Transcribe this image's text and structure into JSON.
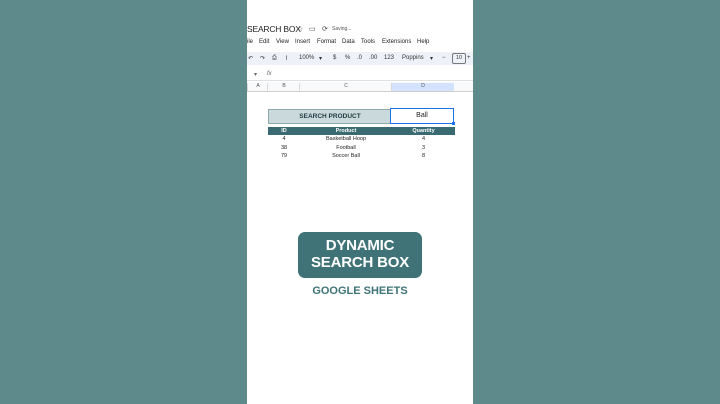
{
  "sheet": {
    "title": "SEARCH BOX",
    "saving_status": "Saving...",
    "title_icons": {
      "star": "star-icon",
      "folder": "folder-move-icon",
      "sync": "sync-icon"
    },
    "menu": [
      "ile",
      "Edit",
      "View",
      "Insert",
      "Format",
      "Data",
      "Tools",
      "Extensions",
      "Help"
    ],
    "toolbar": {
      "zoom": "100%",
      "currency": "$",
      "percent": "%",
      "decimal_decrease": ".0",
      "decimal_increase": ".00",
      "number_format": "123",
      "font": "Poppins",
      "font_size_minus": "−",
      "font_size": "10",
      "font_size_plus": "+"
    },
    "cell_ref_arrow": "▾",
    "formula_icon": "fx",
    "columns": [
      "A",
      "B",
      "C",
      "D"
    ]
  },
  "search": {
    "label": "SEARCH PRODUCT",
    "value": "Ball"
  },
  "table": {
    "headers": [
      "ID",
      "Product",
      "Quantity"
    ],
    "rows": [
      [
        "4",
        "Basketball Hoop",
        "4"
      ],
      [
        "38",
        "Football",
        "3"
      ],
      [
        "79",
        "Soccer Ball",
        "8"
      ]
    ]
  },
  "overlay": {
    "line1": "DYNAMIC",
    "line2": "SEARCH BOX",
    "subtitle": "GOOGLE SHEETS"
  },
  "colors": {
    "background": "#5f8a8b",
    "accent": "#3f7377",
    "header_fill": "#3a6b72",
    "search_label_fill": "#cad9db",
    "selection": "#1a73e8"
  }
}
